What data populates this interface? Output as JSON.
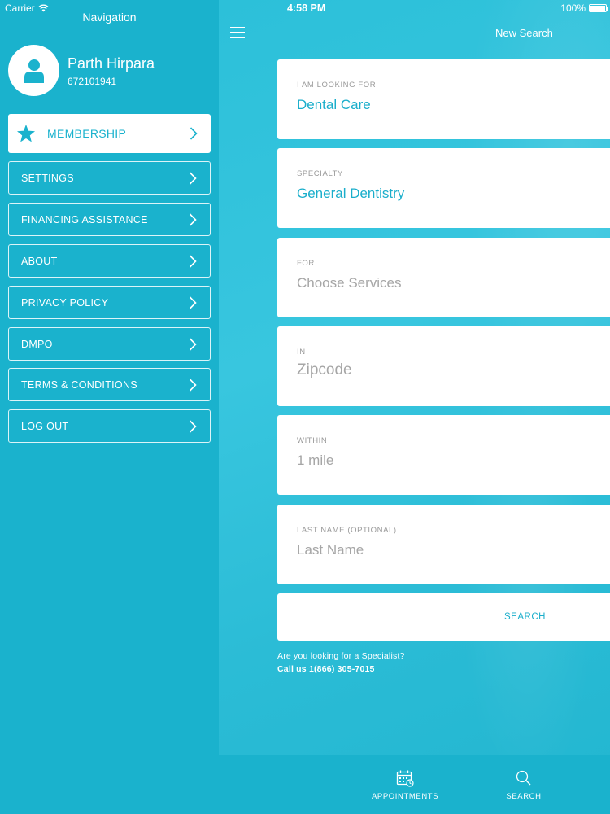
{
  "status_bar": {
    "carrier": "Carrier",
    "time": "4:58 PM",
    "battery": "100%"
  },
  "nav": {
    "title": "Navigation",
    "profile": {
      "name": "Parth Hirpara",
      "id": "672101941"
    },
    "items": [
      {
        "label": "MEMBERSHIP",
        "icon": "star-icon"
      },
      {
        "label": "SETTINGS"
      },
      {
        "label": "FINANCING ASSISTANCE"
      },
      {
        "label": "ABOUT"
      },
      {
        "label": "PRIVACY POLICY"
      },
      {
        "label": "DMPO"
      },
      {
        "label": "TERMS & CONDITIONS"
      },
      {
        "label": "LOG OUT"
      }
    ]
  },
  "main": {
    "title": "New Search",
    "fields": [
      {
        "label": "I AM LOOKING FOR",
        "value": "Dental Care"
      },
      {
        "label": "SPECIALTY",
        "value": "General Dentistry"
      },
      {
        "label": "FOR",
        "placeholder": "Choose Services"
      },
      {
        "label": "IN",
        "placeholder": "Zipcode"
      },
      {
        "label": "WITHIN",
        "placeholder": "1 mile"
      },
      {
        "label": "LAST NAME (OPTIONAL)",
        "placeholder": "Last Name"
      }
    ],
    "search_label": "SEARCH",
    "specialist_question": "Are you looking for a Specialist?",
    "specialist_call": "Call us 1(866) 305-7015"
  },
  "tabbar": {
    "tabs": [
      {
        "label": "APPOINTMENTS",
        "icon": "calendar-icon"
      },
      {
        "label": "SEARCH",
        "icon": "search-icon"
      }
    ]
  },
  "colors": {
    "accent": "#1AB2CD",
    "placeholder": "#A6A6A6"
  }
}
